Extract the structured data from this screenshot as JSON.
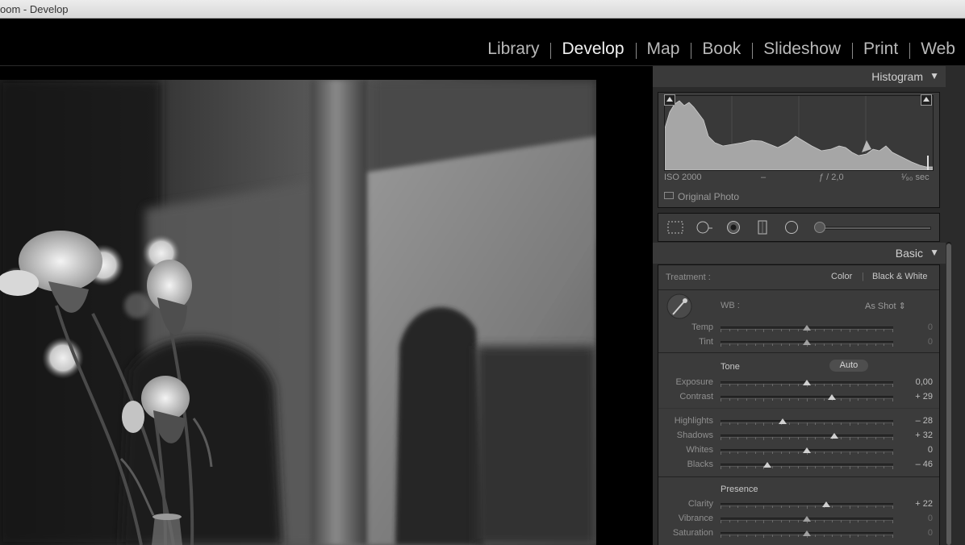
{
  "window": {
    "title": "oom - Develop"
  },
  "modules": [
    {
      "label": "Library",
      "active": false
    },
    {
      "label": "Develop",
      "active": true
    },
    {
      "label": "Map",
      "active": false
    },
    {
      "label": "Book",
      "active": false
    },
    {
      "label": "Slideshow",
      "active": false
    },
    {
      "label": "Print",
      "active": false
    },
    {
      "label": "Web",
      "active": false
    }
  ],
  "histogram": {
    "title": "Histogram",
    "exif": {
      "iso": "ISO 2000",
      "focal": "–",
      "aperture": "ƒ / 2,0",
      "shutter": "¹⁄₉₀ sec"
    },
    "original_photo_label": "Original Photo"
  },
  "basic": {
    "title": "Basic",
    "treatment_label": "Treatment :",
    "treatment_color": "Color",
    "treatment_bw": "Black & White",
    "wb_label": "WB :",
    "wb_value": "As Shot ⇕",
    "tone_label": "Tone",
    "auto_label": "Auto",
    "presence_label": "Presence",
    "sliders": {
      "temp": {
        "label": "Temp",
        "value": "0",
        "pos": 0.5
      },
      "tint": {
        "label": "Tint",
        "value": "0",
        "pos": 0.5
      },
      "exposure": {
        "label": "Exposure",
        "value": "0,00",
        "pos": 0.5
      },
      "contrast": {
        "label": "Contrast",
        "value": "+ 29",
        "pos": 0.645
      },
      "highlights": {
        "label": "Highlights",
        "value": "– 28",
        "pos": 0.36
      },
      "shadows": {
        "label": "Shadows",
        "value": "+ 32",
        "pos": 0.66
      },
      "whites": {
        "label": "Whites",
        "value": "0",
        "pos": 0.5
      },
      "blacks": {
        "label": "Blacks",
        "value": "– 46",
        "pos": 0.27
      },
      "clarity": {
        "label": "Clarity",
        "value": "+ 22",
        "pos": 0.61
      },
      "vibrance": {
        "label": "Vibrance",
        "value": "0",
        "pos": 0.5
      },
      "saturation": {
        "label": "Saturation",
        "value": "0",
        "pos": 0.5
      }
    }
  },
  "colors": {
    "panel_bg": "#2b2b2b",
    "section_bg": "#3b3b3b",
    "active_module": "#f2f2f2",
    "inactive_module": "#b9b9b9"
  }
}
